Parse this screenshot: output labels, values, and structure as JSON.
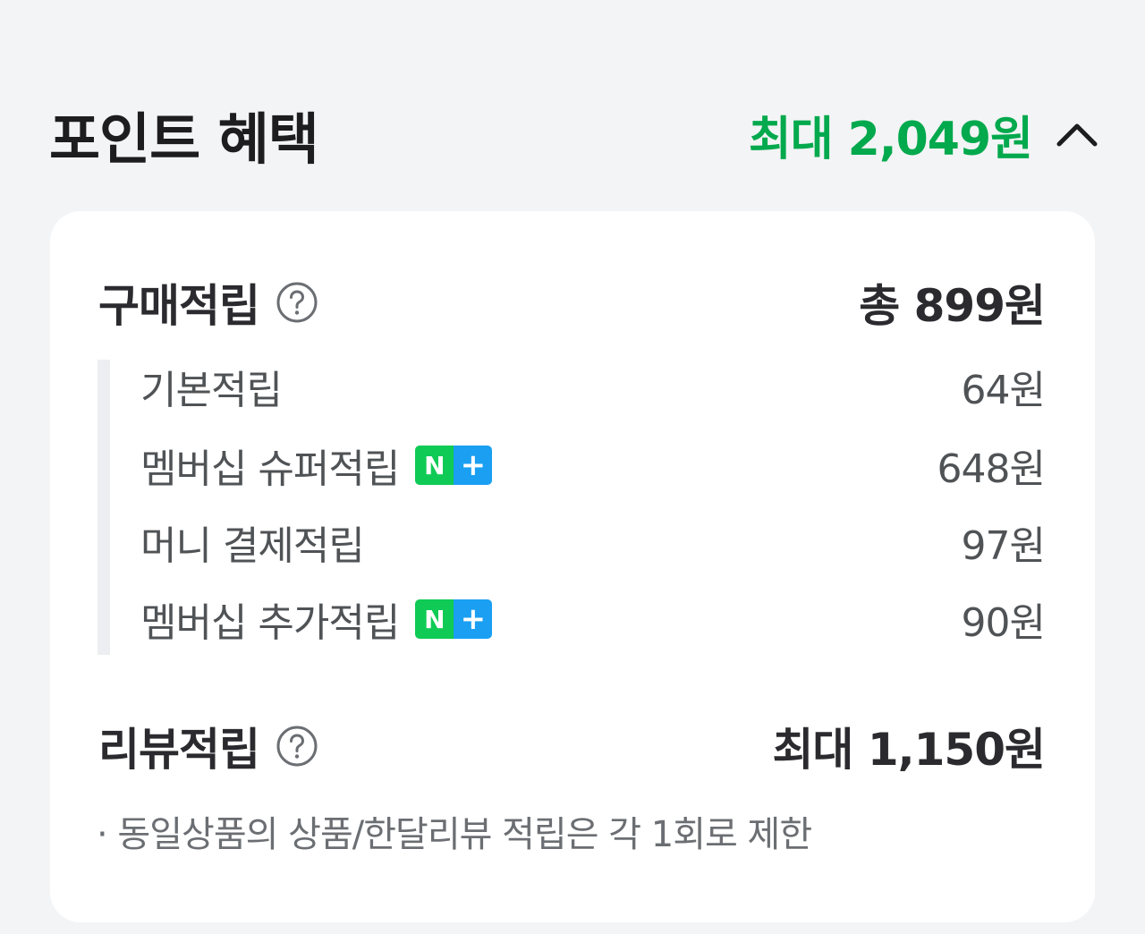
{
  "header": {
    "title": "포인트 혜택",
    "max_total": "최대 2,049원",
    "toggle_icon": "chevron-up-icon"
  },
  "purchase": {
    "label": "구매적립",
    "total": "총 899원",
    "help_icon": "question-circle-icon",
    "items": [
      {
        "label": "기본적립",
        "value": "64원",
        "badge": ""
      },
      {
        "label": "멤버십 슈퍼적립",
        "value": "648원",
        "badge": "N+"
      },
      {
        "label": "머니 결제적립",
        "value": "97원",
        "badge": ""
      },
      {
        "label": "멤버십 추가적립",
        "value": "90원",
        "badge": "N+"
      }
    ]
  },
  "review": {
    "label": "리뷰적립",
    "total": "최대 1,150원",
    "help_icon": "question-circle-icon",
    "note": "· 동일상품의 상품/한달리뷰 적립은 각 1회로 제한"
  },
  "badge": {
    "n_text": "N",
    "plus_text": "+",
    "n_color": "#0fcb55",
    "plus_color": "#1a9ff2"
  },
  "colors": {
    "accent_green": "#03a94d",
    "background": "#f3f4f6",
    "card": "#ffffff"
  }
}
